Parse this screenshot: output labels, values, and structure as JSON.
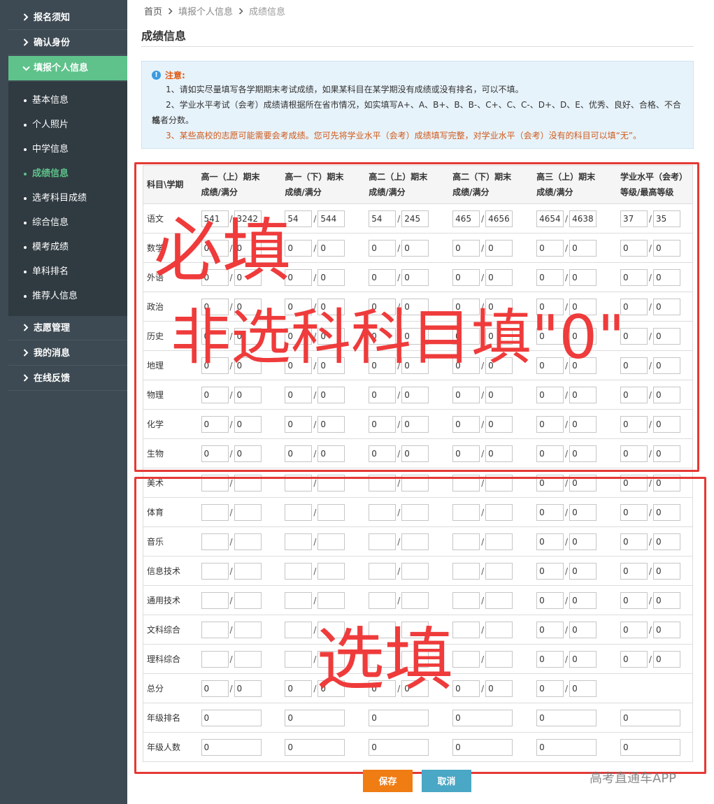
{
  "sidebar": {
    "top_items": [
      {
        "label": "报名须知"
      },
      {
        "label": "确认身份"
      },
      {
        "label": "填报个人信息"
      }
    ],
    "sub_items": [
      {
        "label": "基本信息"
      },
      {
        "label": "个人照片"
      },
      {
        "label": "中学信息"
      },
      {
        "label": "成绩信息"
      },
      {
        "label": "选考科目成绩"
      },
      {
        "label": "综合信息"
      },
      {
        "label": "模考成绩"
      },
      {
        "label": "单科排名"
      },
      {
        "label": "推荐人信息"
      }
    ],
    "bottom_items": [
      {
        "label": "志愿管理"
      },
      {
        "label": "我的消息"
      },
      {
        "label": "在线反馈"
      }
    ],
    "active_sub": "成绩信息"
  },
  "breadcrumb": {
    "home": "首页",
    "level2": "填报个人信息",
    "current": "成绩信息"
  },
  "page_title": "成绩信息",
  "notice": {
    "title": "注意:",
    "line1": "1、请如实尽量填写各学期期末考试成绩，如果某科目在某学期没有成绩或没有排名，可以不填。",
    "line2": "2、学业水平考试（会考）成绩请根据所在省市情况，如实填写A+、A、B+、B、B-、C+、C、C-、D+、D、E、优秀、良好、合格、不合格",
    "line2b": "或者分数。",
    "line3": "3、某些高校的志愿可能需要会考成绩。您可先将学业水平（会考）成绩填写完整，对学业水平（会考）没有的科目可以填“无”。"
  },
  "table": {
    "header": {
      "subject": "科目\\学期",
      "cols": [
        {
          "l1": "高一（上）期末",
          "l2": "成绩/满分"
        },
        {
          "l1": "高一（下）期末",
          "l2": "成绩/满分"
        },
        {
          "l1": "高二（上）期末",
          "l2": "成绩/满分"
        },
        {
          "l1": "高二（下）期末",
          "l2": "成绩/满分"
        },
        {
          "l1": "高三（上）期末",
          "l2": "成绩/满分"
        },
        {
          "l1": "学业水平（会考）",
          "l2": "等级/最高等级"
        }
      ]
    },
    "rows": [
      {
        "subject": "语文",
        "type": "pair",
        "values": [
          [
            "541",
            "3242"
          ],
          [
            "54",
            "544"
          ],
          [
            "54",
            "245"
          ],
          [
            "465",
            "4656"
          ],
          [
            "4654",
            "4638"
          ],
          [
            "37",
            "35"
          ]
        ]
      },
      {
        "subject": "数学",
        "type": "pair",
        "values": [
          [
            "0",
            "0"
          ],
          [
            "0",
            "0"
          ],
          [
            "0",
            "0"
          ],
          [
            "0",
            "0"
          ],
          [
            "0",
            "0"
          ],
          [
            "0",
            "0"
          ]
        ]
      },
      {
        "subject": "外语",
        "type": "pair",
        "values": [
          [
            "0",
            "0"
          ],
          [
            "0",
            "0"
          ],
          [
            "0",
            "0"
          ],
          [
            "0",
            "0"
          ],
          [
            "0",
            "0"
          ],
          [
            "0",
            "0"
          ]
        ]
      },
      {
        "subject": "政治",
        "type": "pair",
        "values": [
          [
            "0",
            "0"
          ],
          [
            "0",
            "0"
          ],
          [
            "0",
            "0"
          ],
          [
            "0",
            "0"
          ],
          [
            "0",
            "0"
          ],
          [
            "0",
            "0"
          ]
        ]
      },
      {
        "subject": "历史",
        "type": "pair",
        "values": [
          [
            "0",
            "0"
          ],
          [
            "0",
            "0"
          ],
          [
            "0",
            "0"
          ],
          [
            "0",
            "0"
          ],
          [
            "0",
            "0"
          ],
          [
            "0",
            "0"
          ]
        ]
      },
      {
        "subject": "地理",
        "type": "pair",
        "values": [
          [
            "0",
            "0"
          ],
          [
            "0",
            "0"
          ],
          [
            "0",
            "0"
          ],
          [
            "0",
            "0"
          ],
          [
            "0",
            "0"
          ],
          [
            "0",
            "0"
          ]
        ]
      },
      {
        "subject": "物理",
        "type": "pair",
        "values": [
          [
            "0",
            "0"
          ],
          [
            "0",
            "0"
          ],
          [
            "0",
            "0"
          ],
          [
            "0",
            "0"
          ],
          [
            "0",
            "0"
          ],
          [
            "0",
            "0"
          ]
        ]
      },
      {
        "subject": "化学",
        "type": "pair",
        "values": [
          [
            "0",
            "0"
          ],
          [
            "0",
            "0"
          ],
          [
            "0",
            "0"
          ],
          [
            "0",
            "0"
          ],
          [
            "0",
            "0"
          ],
          [
            "0",
            "0"
          ]
        ]
      },
      {
        "subject": "生物",
        "type": "pair",
        "values": [
          [
            "0",
            "0"
          ],
          [
            "0",
            "0"
          ],
          [
            "0",
            "0"
          ],
          [
            "0",
            "0"
          ],
          [
            "0",
            "0"
          ],
          [
            "0",
            "0"
          ]
        ]
      },
      {
        "subject": "美术",
        "type": "pair",
        "values": [
          [
            "",
            ""
          ],
          [
            "",
            ""
          ],
          [
            "",
            ""
          ],
          [
            "",
            ""
          ],
          [
            "0",
            "0"
          ],
          [
            "0",
            "0"
          ]
        ]
      },
      {
        "subject": "体育",
        "type": "pair",
        "values": [
          [
            "",
            ""
          ],
          [
            "",
            ""
          ],
          [
            "",
            ""
          ],
          [
            "",
            ""
          ],
          [
            "0",
            "0"
          ],
          [
            "0",
            "0"
          ]
        ]
      },
      {
        "subject": "音乐",
        "type": "pair",
        "values": [
          [
            "",
            ""
          ],
          [
            "",
            ""
          ],
          [
            "",
            ""
          ],
          [
            "",
            ""
          ],
          [
            "0",
            "0"
          ],
          [
            "0",
            "0"
          ]
        ]
      },
      {
        "subject": "信息技术",
        "type": "pair",
        "values": [
          [
            "",
            ""
          ],
          [
            "",
            ""
          ],
          [
            "",
            ""
          ],
          [
            "",
            ""
          ],
          [
            "0",
            "0"
          ],
          [
            "0",
            "0"
          ]
        ]
      },
      {
        "subject": "通用技术",
        "type": "pair",
        "values": [
          [
            "",
            ""
          ],
          [
            "",
            ""
          ],
          [
            "",
            ""
          ],
          [
            "",
            ""
          ],
          [
            "0",
            "0"
          ],
          [
            "0",
            "0"
          ]
        ]
      },
      {
        "subject": "文科综合",
        "type": "pair",
        "values": [
          [
            "",
            ""
          ],
          [
            "",
            ""
          ],
          [
            "",
            ""
          ],
          [
            "",
            ""
          ],
          [
            "0",
            "0"
          ],
          [
            "0",
            "0"
          ]
        ]
      },
      {
        "subject": "理科综合",
        "type": "pair",
        "values": [
          [
            "",
            ""
          ],
          [
            "",
            ""
          ],
          [
            "",
            ""
          ],
          [
            "",
            ""
          ],
          [
            "0",
            "0"
          ],
          [
            "0",
            "0"
          ]
        ]
      },
      {
        "subject": "总分",
        "type": "pair",
        "values": [
          [
            "0",
            "0"
          ],
          [
            "0",
            "0"
          ],
          [
            "0",
            "0"
          ],
          [
            "0",
            "0"
          ],
          [
            "0",
            "0"
          ],
          null
        ]
      },
      {
        "subject": "年级排名",
        "type": "single",
        "values": [
          "0",
          "0",
          "0",
          "0",
          "0",
          "0"
        ]
      },
      {
        "subject": "年级人数",
        "type": "single",
        "values": [
          "0",
          "0",
          "0",
          "0",
          "0",
          "0"
        ]
      }
    ]
  },
  "buttons": {
    "save": "保存",
    "cancel": "取消"
  },
  "annotations": {
    "required": "必填",
    "non_elective": "非选科科目填\"0\"",
    "optional": "选填",
    "color": "#e53935"
  },
  "watermark": "高考直通车APP"
}
